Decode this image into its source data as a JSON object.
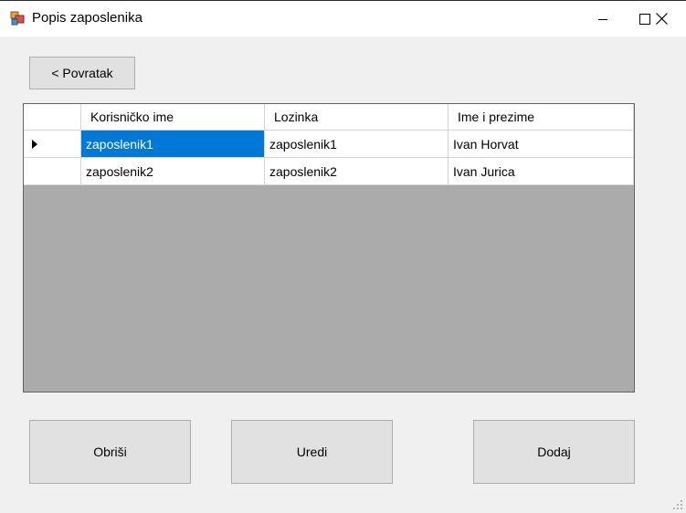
{
  "window": {
    "title": "Popis zaposlenika",
    "minimize_icon": "minimize-icon",
    "maximize_icon": "maximize-icon",
    "close_icon": "close-icon"
  },
  "back_button": {
    "label": "< Povratak"
  },
  "grid": {
    "columns": [
      "Korisničko ime",
      "Lozinka",
      "Ime i prezime"
    ],
    "rows": [
      {
        "current": true,
        "cells": [
          "zaposlenik1",
          "zaposlenik1",
          "Ivan Horvat"
        ]
      },
      {
        "current": false,
        "cells": [
          "zaposlenik2",
          "zaposlenik2",
          "Ivan Jurica"
        ]
      }
    ],
    "selected_cell": {
      "row": 0,
      "column": 0
    }
  },
  "actions": {
    "delete_label": "Obriši",
    "edit_label": "Uredi",
    "add_label": "Dodaj"
  },
  "colors": {
    "selection": "#0078d7",
    "window_bg": "#f0f0f0",
    "grid_bg": "#ababab",
    "button_bg": "#e1e1e1"
  }
}
